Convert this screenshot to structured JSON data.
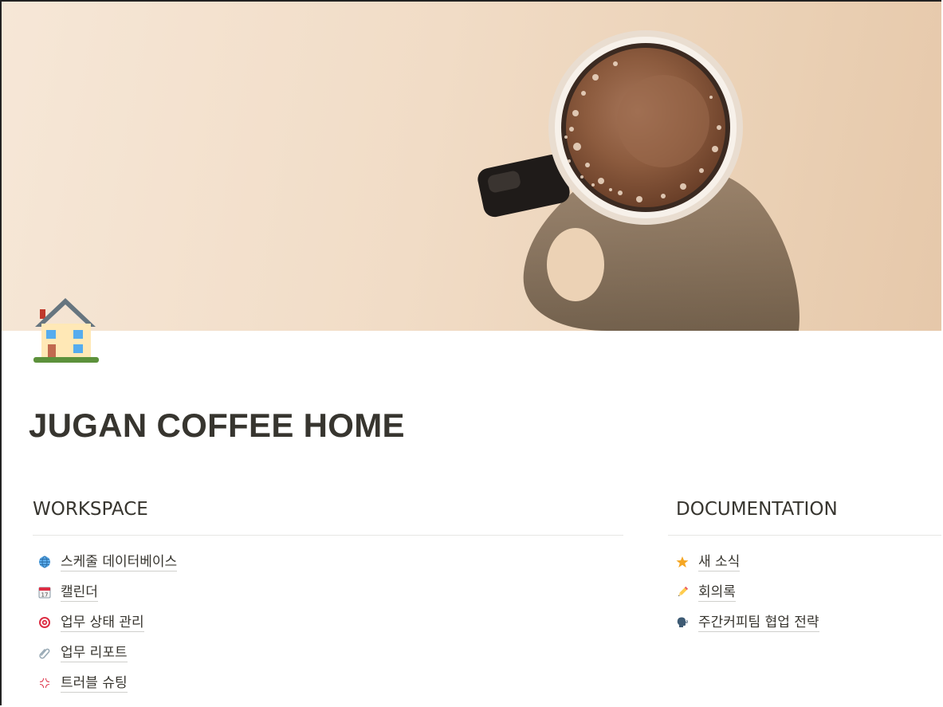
{
  "page": {
    "title": "JUGAN COFFEE HOME",
    "icon": "house-icon",
    "cover": "coffee-cup-cover"
  },
  "workspace": {
    "heading": "WORKSPACE",
    "items": [
      {
        "icon": "globe-icon",
        "label": "스케줄 데이터베이스"
      },
      {
        "icon": "calendar-icon",
        "label": "캘린더"
      },
      {
        "icon": "target-icon",
        "label": "업무 상태 관리"
      },
      {
        "icon": "paperclip-icon",
        "label": "업무 리포트"
      },
      {
        "icon": "anger-icon",
        "label": "트러블 슈팅"
      }
    ]
  },
  "documentation": {
    "heading": "DOCUMENTATION",
    "items": [
      {
        "icon": "star-icon",
        "label": "새 소식"
      },
      {
        "icon": "pencil-icon",
        "label": "회의록"
      },
      {
        "icon": "speaking-head-icon",
        "label": "주간커피팀 협업 전략"
      }
    ]
  },
  "colors": {
    "text": "#37352f",
    "cover_bg": "#f1dcc6",
    "coffee": "#8a5a3c",
    "mug_handle": "#2a2522",
    "star": "#f5a623",
    "target": "#e0245e"
  }
}
